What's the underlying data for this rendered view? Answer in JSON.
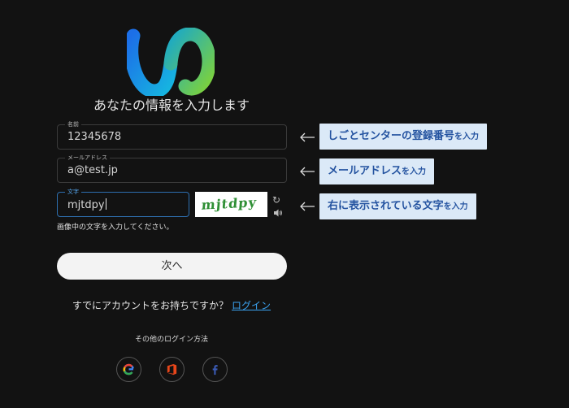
{
  "heading": "あなたの情報を入力します",
  "fields": {
    "name": {
      "label": "名前",
      "value": "12345678"
    },
    "email": {
      "label": "メールアドレス",
      "value": "a@test.jp"
    },
    "captcha": {
      "label": "文字",
      "value": "mjtdpy"
    }
  },
  "captcha_image_text": "mjtdpy",
  "captcha_hint": "画像中の文字を入力してください。",
  "next_button": "次へ",
  "account_prompt": "すでにアカウントをお持ちですか？",
  "login_link": "ログイン",
  "other_login": "その他のログイン方法",
  "social": [
    "google-icon",
    "office-icon",
    "facebook-icon"
  ],
  "callouts": [
    {
      "main": "しごとセンターの登録番号",
      "suffix": "を入力"
    },
    {
      "main": "メールアドレス",
      "suffix": "を入力"
    },
    {
      "main": "右に表示されている文字",
      "suffix": "を入力"
    }
  ],
  "colors": {
    "background": "#121212",
    "accent": "#3aa2f0",
    "callout_bg": "#dbe9f7",
    "callout_text": "#2453a0"
  }
}
